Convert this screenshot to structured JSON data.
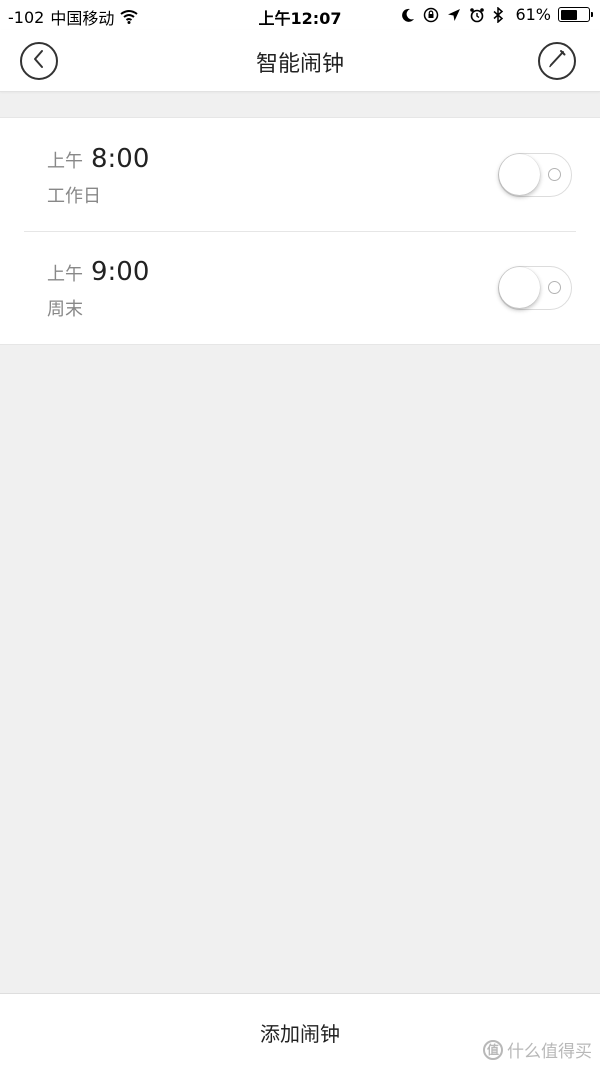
{
  "status_bar": {
    "signal": "-102",
    "carrier": "中国移动",
    "time": "上午12:07",
    "battery_text": "61%",
    "battery_level": 0.61,
    "icons": [
      "wifi-icon",
      "moon-icon",
      "rotation-lock-icon",
      "location-arrow-icon",
      "alarm-clock-icon",
      "bluetooth-icon",
      "battery-icon"
    ]
  },
  "nav": {
    "title": "智能闹钟",
    "back_icon": "back-chevron-icon",
    "edit_icon": "pencil-icon"
  },
  "alarms": [
    {
      "period": "上午",
      "time": "8:00",
      "label": "工作日",
      "enabled": false
    },
    {
      "period": "上午",
      "time": "9:00",
      "label": "周末",
      "enabled": false
    }
  ],
  "bottom": {
    "add_label": "添加闹钟"
  },
  "watermark": {
    "logo_text": "值",
    "text": "什么值得买"
  },
  "colors": {
    "background": "#f0f0f0",
    "surface": "#ffffff",
    "text_primary": "#222222",
    "text_secondary": "#888888",
    "divider": "#e6e6e6"
  }
}
